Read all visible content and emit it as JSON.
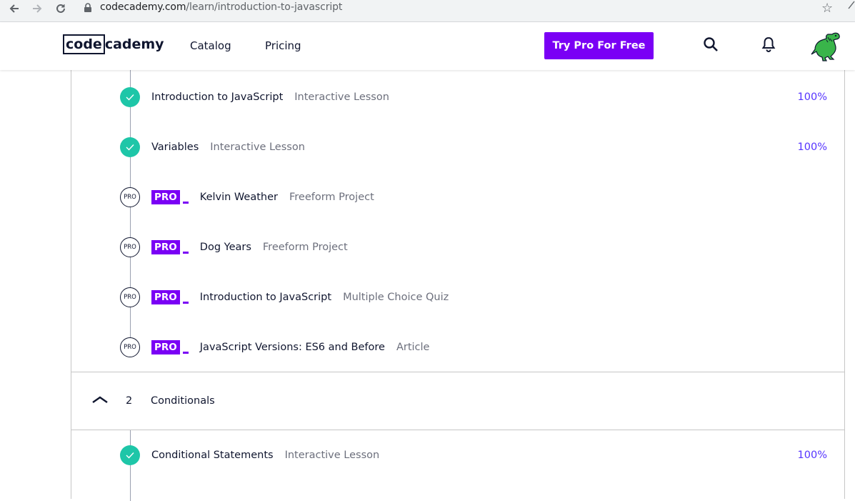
{
  "browser": {
    "url_domain": "codecademy.com",
    "url_path": "/learn/introduction-to-javascript",
    "back_icon": "←",
    "forward_icon": "→",
    "reload_icon": "↻",
    "bookmark_icon": "☆"
  },
  "header": {
    "logo_left": "code",
    "logo_right": "cademy",
    "nav": [
      "Catalog",
      "Pricing"
    ],
    "cta_label": "Try Pro For Free",
    "brand_color": "#7a00f5"
  },
  "module1": {
    "lessons": [
      {
        "title": "Introduction to JavaScript",
        "type": "Interactive Lesson",
        "progress": "100%",
        "status": "complete"
      },
      {
        "title": "Variables",
        "type": "Interactive Lesson",
        "progress": "100%",
        "status": "complete"
      },
      {
        "title": "Kelvin Weather",
        "type": "Freeform Project",
        "pro": "PRO",
        "status_label": "PRO"
      },
      {
        "title": "Dog Years",
        "type": "Freeform Project",
        "pro": "PRO",
        "status_label": "PRO"
      },
      {
        "title": "Introduction to JavaScript",
        "type": "Multiple Choice Quiz",
        "pro": "PRO",
        "status_label": "PRO"
      },
      {
        "title": "JavaScript Versions: ES6 and Before",
        "type": "Article",
        "pro": "PRO",
        "status_label": "PRO"
      }
    ]
  },
  "module2": {
    "number": "2",
    "title": "Conditionals",
    "lessons": [
      {
        "title": "Conditional Statements",
        "type": "Interactive Lesson",
        "progress": "100%",
        "status": "complete"
      }
    ]
  }
}
